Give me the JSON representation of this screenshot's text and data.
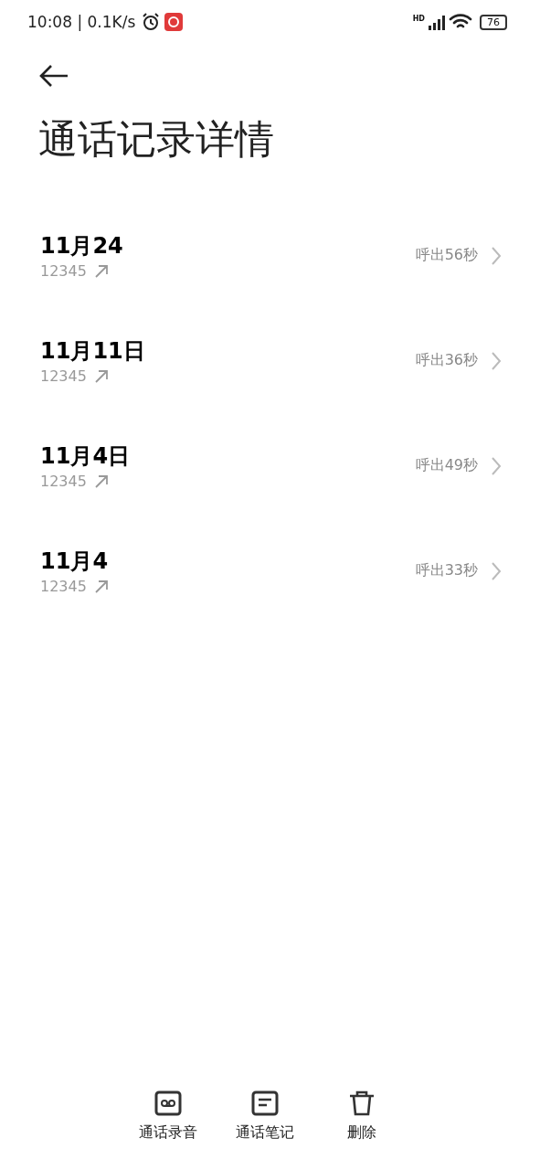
{
  "status_bar": {
    "time": "10:08 | 0.1K/s",
    "network": "HD",
    "battery": "76"
  },
  "title": "通话记录详情",
  "calls": [
    {
      "date": "11月24",
      "number": "12345",
      "outgoing": true,
      "summary": "呼出56秒"
    },
    {
      "date": "11月11日",
      "number": "12345",
      "outgoing": true,
      "summary": "呼出36秒"
    },
    {
      "date": "11月4日",
      "number": "12345",
      "outgoing": true,
      "summary": "呼出49秒"
    },
    {
      "date": "11月4",
      "number": "12345",
      "outgoing": true,
      "summary": "呼出33秒"
    }
  ],
  "actions": [
    {
      "kind": "recording",
      "label": "通话录音"
    },
    {
      "kind": "notes",
      "label": "通话笔记"
    },
    {
      "kind": "delete",
      "label": "删除"
    }
  ]
}
